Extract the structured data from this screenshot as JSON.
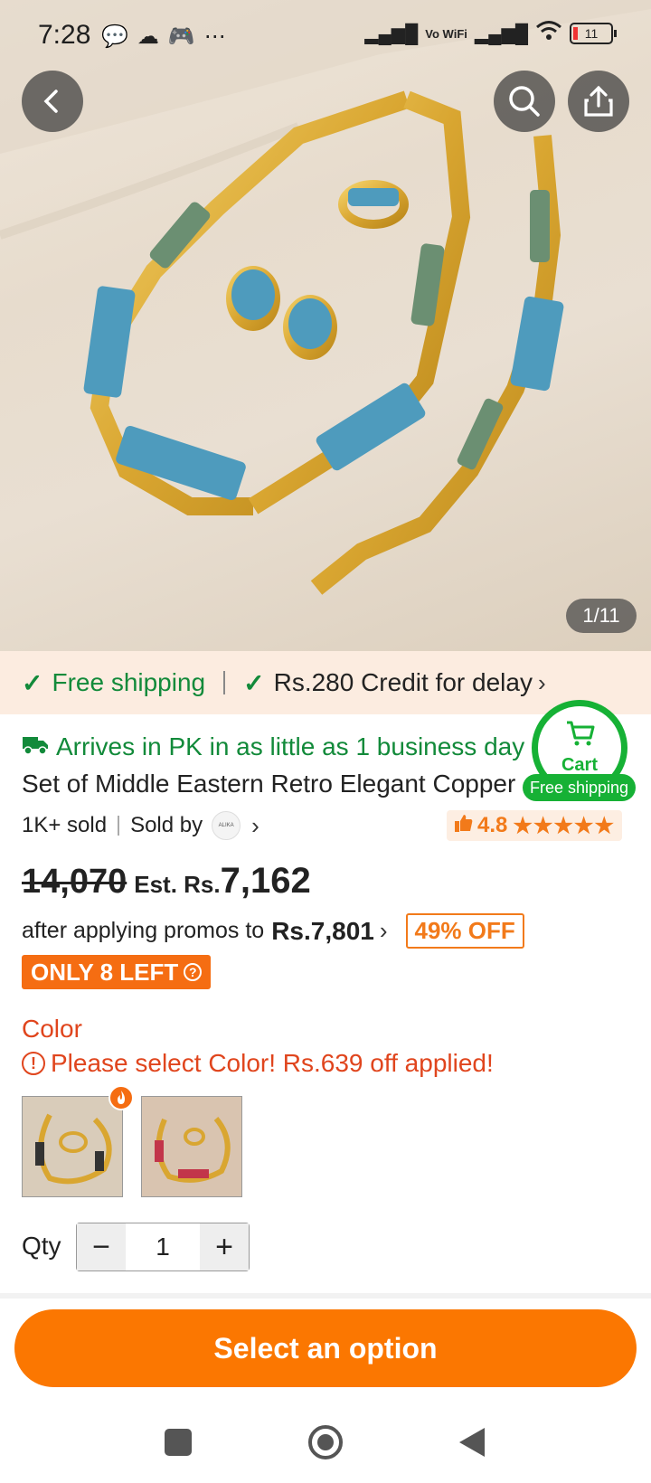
{
  "status_bar": {
    "time": "7:28",
    "network_label": "Vo WiFi",
    "battery_level": "11"
  },
  "gallery": {
    "page_indicator": "1/11"
  },
  "shipping_banner": {
    "free_shipping": "Free shipping",
    "credit": "Rs.280 Credit for delay"
  },
  "arrival": {
    "text": "Arrives in PK in as little as 1 business day"
  },
  "product": {
    "title": "Set of Middle Eastern Retro Elegant Copper",
    "sold": "1K+ sold",
    "sold_by": "Sold by",
    "seller_logo": "ALIKA",
    "rating": "4.8",
    "stars": "★★★★★"
  },
  "cart": {
    "label": "Cart",
    "badge": "Free shipping"
  },
  "price": {
    "old": "14,070",
    "est_label": "Est. Rs.",
    "current": "7,162",
    "promo_prefix": "after applying promos to",
    "promo_price": "Rs.7,801",
    "discount": "49% OFF",
    "stock": "ONLY 8 LEFT"
  },
  "color": {
    "label": "Color",
    "warning": "Please select Color! Rs.639 off applied!"
  },
  "qty": {
    "label": "Qty",
    "value": "1",
    "minus": "−",
    "plus": "+"
  },
  "cta": {
    "label": "Select an option"
  },
  "colors": {
    "accent": "#fb7701",
    "green": "#128a3a",
    "cart_green": "#16b135",
    "warning": "#e0451d"
  }
}
